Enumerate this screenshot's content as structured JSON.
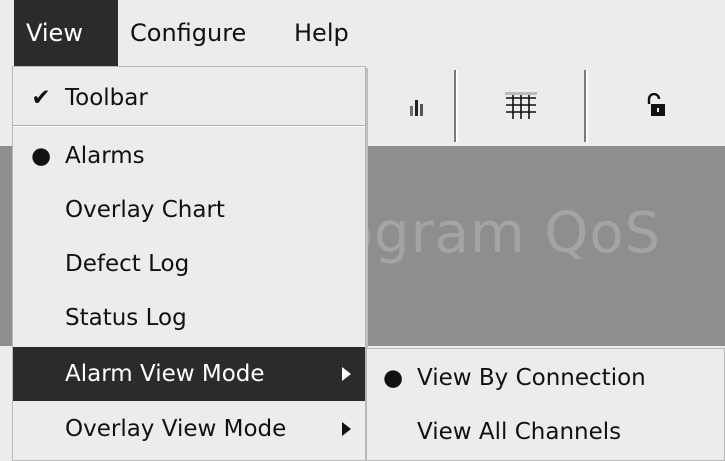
{
  "menubar": {
    "items": [
      {
        "label": "View"
      },
      {
        "label": "Configure"
      },
      {
        "label": "Help"
      }
    ]
  },
  "background": {
    "watermark_text": "rogram QoS"
  },
  "view_menu": {
    "items": [
      {
        "label": "Toolbar",
        "mark": "✔"
      },
      {
        "label": "Alarms",
        "mark": "●"
      },
      {
        "label": "Overlay Chart",
        "mark": ""
      },
      {
        "label": "Defect Log",
        "mark": ""
      },
      {
        "label": "Status Log",
        "mark": ""
      },
      {
        "label": "Alarm View Mode",
        "mark": ""
      },
      {
        "label": "Overlay View Mode",
        "mark": ""
      }
    ]
  },
  "alarm_view_submenu": {
    "items": [
      {
        "label": "View By Connection",
        "mark": "●"
      },
      {
        "label": "View All Channels",
        "mark": ""
      }
    ]
  },
  "icons": {
    "toolbar_btn_1": "bar-chart-icon",
    "toolbar_btn_2": "grid-icon",
    "toolbar_btn_3": "unlock-icon"
  },
  "colors": {
    "highlight": "#2b2b2b",
    "menu_bg": "#ececec",
    "panel": "#8e8e8e"
  }
}
